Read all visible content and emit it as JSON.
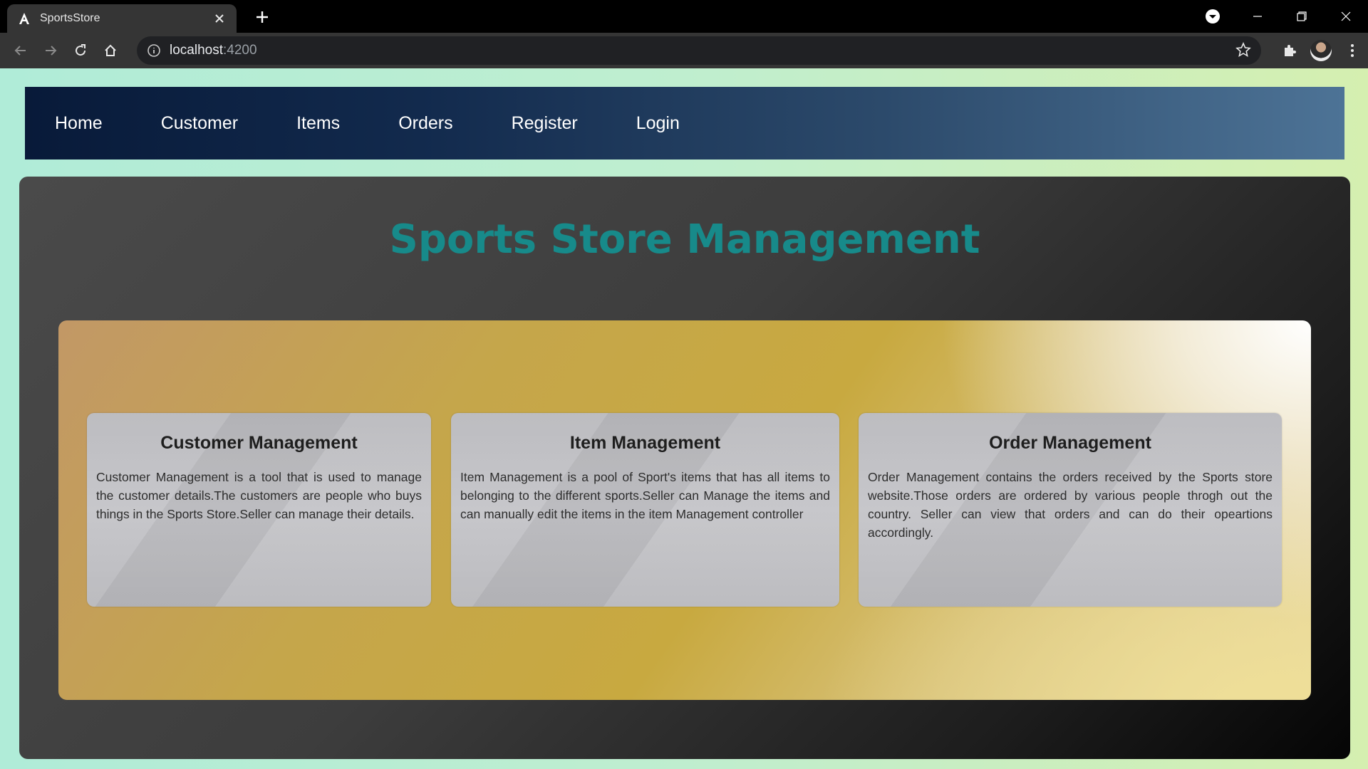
{
  "browser": {
    "tab_title": "SportsStore",
    "url_host": "localhost",
    "url_port": ":4200"
  },
  "navbar": {
    "links": [
      "Home",
      "Customer",
      "Items",
      "Orders",
      "Register",
      "Login"
    ]
  },
  "main": {
    "title": "Sports Store Management",
    "cards": [
      {
        "title": "Customer Management",
        "text": "Customer Management is a tool that is used to manage the customer details.The customers are people who buys things in the Sports Store.Seller can manage their details."
      },
      {
        "title": "Item Management",
        "text": "Item Management is a pool of Sport's items that has all items to belonging to the different sports.Seller can Manage the items and can manually edit the items in the item Management controller"
      },
      {
        "title": "Order Management",
        "text": "Order Management contains the orders received by the Sports store website.Those orders are ordered by various people throgh out the country. Seller can view that orders and can do their opeartions accordingly."
      }
    ]
  },
  "colors": {
    "title_teal": "#178a8a",
    "navbar_dark": "#081a39",
    "navbar_light": "#4d7396",
    "gold": "#c8a940"
  }
}
